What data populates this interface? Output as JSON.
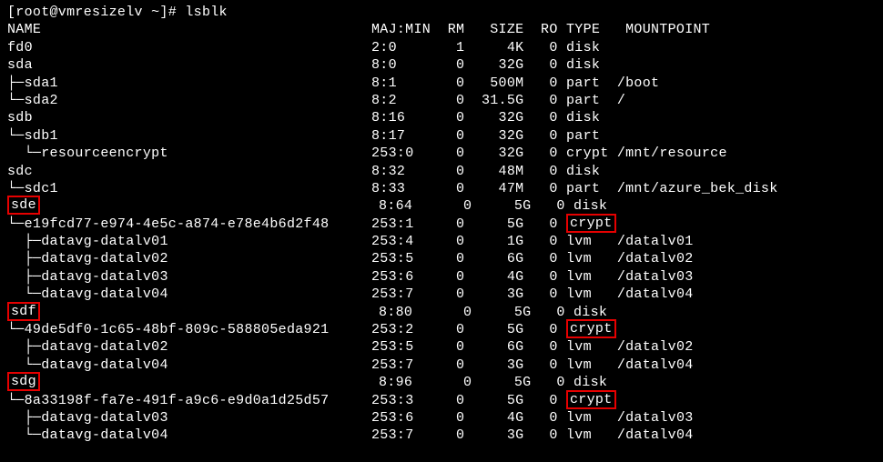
{
  "prompt": "[root@vmresizelv ~]# ",
  "command": "lsblk",
  "header": {
    "name": "NAME",
    "majmin": "MAJ:MIN",
    "rm": "RM",
    "size": "SIZE",
    "ro": "RO",
    "type": "TYPE",
    "mount": "MOUNTPOINT"
  },
  "rows": [
    {
      "tree": "",
      "name": "fd0",
      "majmin": "2:0",
      "rm": "1",
      "size": "4K",
      "ro": "0",
      "type": "disk",
      "mount": "",
      "hlName": false,
      "hlType": false
    },
    {
      "tree": "",
      "name": "sda",
      "majmin": "8:0",
      "rm": "0",
      "size": "32G",
      "ro": "0",
      "type": "disk",
      "mount": "",
      "hlName": false,
      "hlType": false
    },
    {
      "tree": "├─",
      "name": "sda1",
      "majmin": "8:1",
      "rm": "0",
      "size": "500M",
      "ro": "0",
      "type": "part",
      "mount": "/boot",
      "hlName": false,
      "hlType": false
    },
    {
      "tree": "└─",
      "name": "sda2",
      "majmin": "8:2",
      "rm": "0",
      "size": "31.5G",
      "ro": "0",
      "type": "part",
      "mount": "/",
      "hlName": false,
      "hlType": false
    },
    {
      "tree": "",
      "name": "sdb",
      "majmin": "8:16",
      "rm": "0",
      "size": "32G",
      "ro": "0",
      "type": "disk",
      "mount": "",
      "hlName": false,
      "hlType": false
    },
    {
      "tree": "└─",
      "name": "sdb1",
      "majmin": "8:17",
      "rm": "0",
      "size": "32G",
      "ro": "0",
      "type": "part",
      "mount": "",
      "hlName": false,
      "hlType": false
    },
    {
      "tree": "  └─",
      "name": "resourceencrypt",
      "majmin": "253:0",
      "rm": "0",
      "size": "32G",
      "ro": "0",
      "type": "crypt",
      "mount": "/mnt/resource",
      "hlName": false,
      "hlType": false
    },
    {
      "tree": "",
      "name": "sdc",
      "majmin": "8:32",
      "rm": "0",
      "size": "48M",
      "ro": "0",
      "type": "disk",
      "mount": "",
      "hlName": false,
      "hlType": false
    },
    {
      "tree": "└─",
      "name": "sdc1",
      "majmin": "8:33",
      "rm": "0",
      "size": "47M",
      "ro": "0",
      "type": "part",
      "mount": "/mnt/azure_bek_disk",
      "hlName": false,
      "hlType": false
    },
    {
      "tree": "",
      "name": "sde",
      "majmin": "8:64",
      "rm": "0",
      "size": "5G",
      "ro": "0",
      "type": "disk",
      "mount": "",
      "hlName": true,
      "hlType": false
    },
    {
      "tree": "└─",
      "name": "e19fcd77-e974-4e5c-a874-e78e4b6d2f48",
      "majmin": "253:1",
      "rm": "0",
      "size": "5G",
      "ro": "0",
      "type": "crypt",
      "mount": "",
      "hlName": false,
      "hlType": true
    },
    {
      "tree": "  ├─",
      "name": "datavg-datalv01",
      "majmin": "253:4",
      "rm": "0",
      "size": "1G",
      "ro": "0",
      "type": "lvm",
      "mount": "/datalv01",
      "hlName": false,
      "hlType": false
    },
    {
      "tree": "  ├─",
      "name": "datavg-datalv02",
      "majmin": "253:5",
      "rm": "0",
      "size": "6G",
      "ro": "0",
      "type": "lvm",
      "mount": "/datalv02",
      "hlName": false,
      "hlType": false
    },
    {
      "tree": "  ├─",
      "name": "datavg-datalv03",
      "majmin": "253:6",
      "rm": "0",
      "size": "4G",
      "ro": "0",
      "type": "lvm",
      "mount": "/datalv03",
      "hlName": false,
      "hlType": false
    },
    {
      "tree": "  └─",
      "name": "datavg-datalv04",
      "majmin": "253:7",
      "rm": "0",
      "size": "3G",
      "ro": "0",
      "type": "lvm",
      "mount": "/datalv04",
      "hlName": false,
      "hlType": false
    },
    {
      "tree": "",
      "name": "sdf",
      "majmin": "8:80",
      "rm": "0",
      "size": "5G",
      "ro": "0",
      "type": "disk",
      "mount": "",
      "hlName": true,
      "hlType": false
    },
    {
      "tree": "└─",
      "name": "49de5df0-1c65-48bf-809c-588805eda921",
      "majmin": "253:2",
      "rm": "0",
      "size": "5G",
      "ro": "0",
      "type": "crypt",
      "mount": "",
      "hlName": false,
      "hlType": true
    },
    {
      "tree": "  ├─",
      "name": "datavg-datalv02",
      "majmin": "253:5",
      "rm": "0",
      "size": "6G",
      "ro": "0",
      "type": "lvm",
      "mount": "/datalv02",
      "hlName": false,
      "hlType": false
    },
    {
      "tree": "  └─",
      "name": "datavg-datalv04",
      "majmin": "253:7",
      "rm": "0",
      "size": "3G",
      "ro": "0",
      "type": "lvm",
      "mount": "/datalv04",
      "hlName": false,
      "hlType": false
    },
    {
      "tree": "",
      "name": "sdg",
      "majmin": "8:96",
      "rm": "0",
      "size": "5G",
      "ro": "0",
      "type": "disk",
      "mount": "",
      "hlName": true,
      "hlType": false
    },
    {
      "tree": "└─",
      "name": "8a33198f-fa7e-491f-a9c6-e9d0a1d25d57",
      "majmin": "253:3",
      "rm": "0",
      "size": "5G",
      "ro": "0",
      "type": "crypt",
      "mount": "",
      "hlName": false,
      "hlType": true
    },
    {
      "tree": "  ├─",
      "name": "datavg-datalv03",
      "majmin": "253:6",
      "rm": "0",
      "size": "4G",
      "ro": "0",
      "type": "lvm",
      "mount": "/datalv03",
      "hlName": false,
      "hlType": false
    },
    {
      "tree": "  └─",
      "name": "datavg-datalv04",
      "majmin": "253:7",
      "rm": "0",
      "size": "3G",
      "ro": "0",
      "type": "lvm",
      "mount": "/datalv04",
      "hlName": false,
      "hlType": false
    }
  ],
  "widths": {
    "name": 43,
    "majmin": 7,
    "rm": 3,
    "size": 6,
    "ro": 3,
    "type": 5
  }
}
